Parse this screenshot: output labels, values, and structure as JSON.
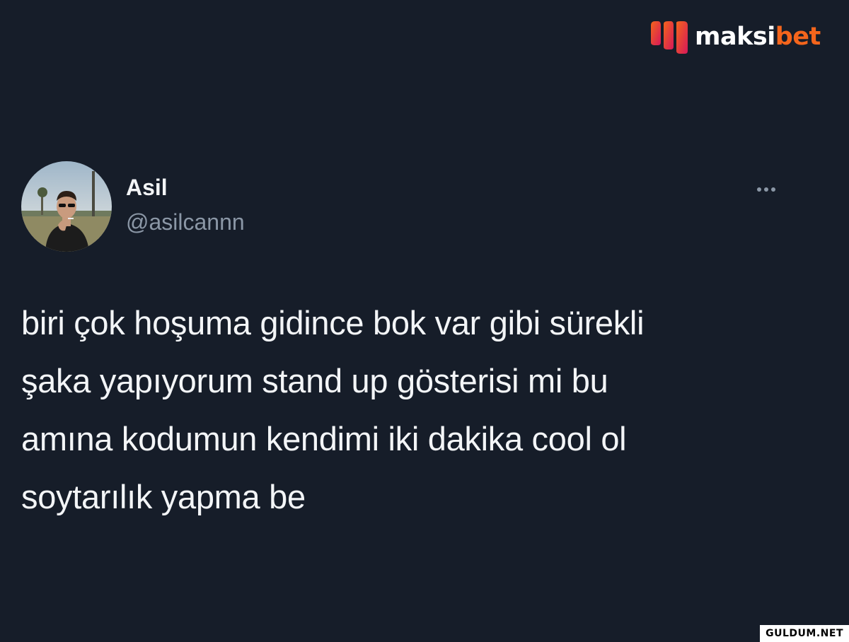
{
  "brand": {
    "logo_icon": "maksibet-logo-mark",
    "name_part1": "maksi",
    "name_part2": "bet",
    "primary_color": "#f4651c",
    "accent_color": "#d6185a"
  },
  "tweet": {
    "author": {
      "display_name": "Asil",
      "handle": "@asilcannn",
      "avatar_icon": "profile-photo"
    },
    "more_icon": "more-horizontal-icon",
    "text_lines": [
      "biri çok hoşuma gidince bok var gibi sürekli",
      "şaka yapıyorum stand up gösterisi mi bu",
      "amına kodumun kendimi iki dakika cool ol",
      "soytarılık yapma be"
    ]
  },
  "watermark": {
    "text": "GULDUM.NET"
  },
  "colors": {
    "background": "#161d29",
    "text_primary": "#f3f5f7",
    "text_secondary": "#8b97a6"
  }
}
